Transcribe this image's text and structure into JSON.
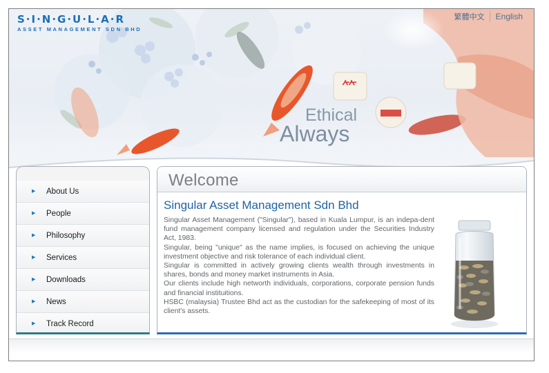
{
  "header": {
    "logo_text": "S·I·N·G·U·L·A·R",
    "logo_subtitle": "ASSET MANAGEMENT SDN BHD",
    "languages": [
      "繁體中文",
      "English"
    ]
  },
  "banner": {
    "tagline_line1": "Ethical",
    "tagline_line2": "Always"
  },
  "sidebar": {
    "items": [
      {
        "label": "About Us"
      },
      {
        "label": "People"
      },
      {
        "label": "Philosophy"
      },
      {
        "label": "Services"
      },
      {
        "label": "Downloads"
      },
      {
        "label": "News"
      },
      {
        "label": "Track Record"
      }
    ]
  },
  "main": {
    "section_heading": "Welcome",
    "title": "Singular Asset Management Sdn Bhd",
    "paragraphs": [
      "Singular Asset Management (\"Singular\"), based in Kuala Lumpur, is an indepa-dent fund management company licensed and regulation under the Securities Industry Act, 1983.",
      "Singular, being \"unique\" as the name implies, is focused on achieving the unique investment objective and risk tolerance of each individual client.",
      "Singular is committed in actively growing clients wealth through investments in shares, bonds and money market instruments in Asia.",
      "Our clients include high networth individuals, corporations, corporate pension funds and financial instituitions.",
      "HSBC (malaysia) Trustee Bhd act as the custodian for the safekeeping of most of its client's assets."
    ]
  },
  "colors": {
    "brand_blue": "#1d6fb8",
    "title_blue": "#1e62a6",
    "nav_accent": "#2c7c84",
    "content_accent": "#2a6cb3"
  },
  "icons": {
    "nav_bullet": "bullet-arrow-icon",
    "banner_art": "koi-fish-illustration",
    "jar_art": "coin-jar-image"
  }
}
